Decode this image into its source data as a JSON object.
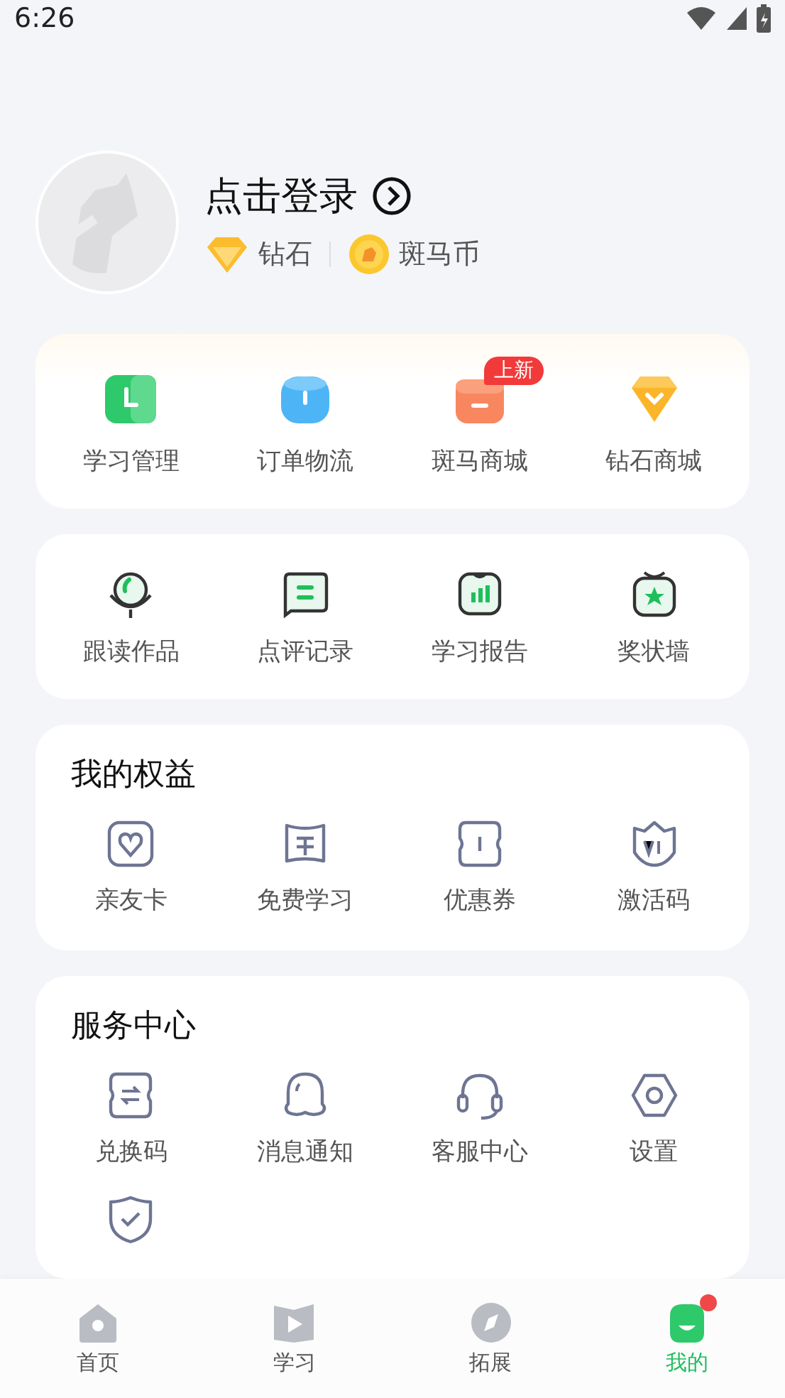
{
  "status_bar": {
    "time": "6:26"
  },
  "profile": {
    "login": "点击登录",
    "diamond": "钻石",
    "coins": "斑马币"
  },
  "quick_links": [
    {
      "label": "学习管理"
    },
    {
      "label": "订单物流"
    },
    {
      "label": "斑马商城",
      "badge": "上新"
    },
    {
      "label": "钻石商城"
    }
  ],
  "tools": [
    {
      "label": "跟读作品"
    },
    {
      "label": "点评记录"
    },
    {
      "label": "学习报告"
    },
    {
      "label": "奖状墙"
    }
  ],
  "benefits": {
    "title": "我的权益",
    "items": [
      {
        "label": "亲友卡"
      },
      {
        "label": "免费学习"
      },
      {
        "label": "优惠券"
      },
      {
        "label": "激活码"
      }
    ]
  },
  "services": {
    "title": "服务中心",
    "cut_off_item": true,
    "items": [
      {
        "label": "兑换码"
      },
      {
        "label": "消息通知"
      },
      {
        "label": "客服中心"
      },
      {
        "label": "设置"
      }
    ]
  },
  "tabs": [
    {
      "label": "首页",
      "selected": false,
      "dot": false
    },
    {
      "label": "学习",
      "selected": false,
      "dot": false
    },
    {
      "label": "拓展",
      "selected": false,
      "dot": false
    },
    {
      "label": "我的",
      "selected": true,
      "dot": true
    }
  ]
}
